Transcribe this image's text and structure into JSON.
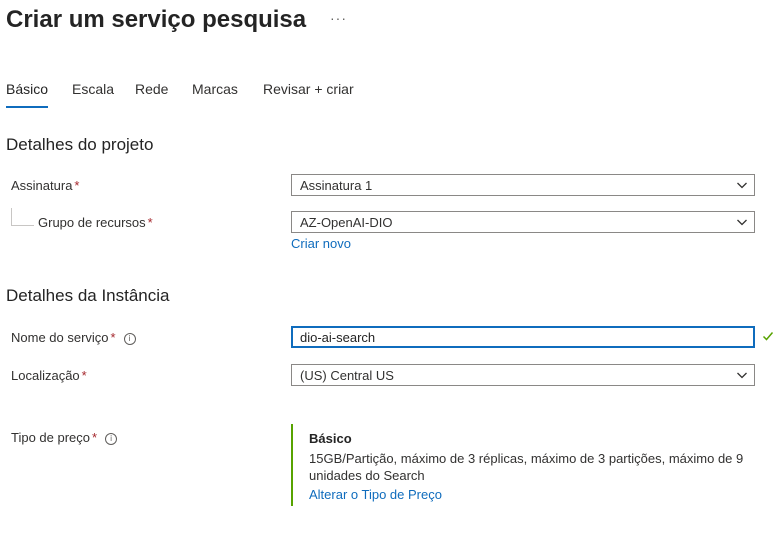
{
  "page": {
    "title": "Criar um serviço pesquisa",
    "more_label": "···"
  },
  "tabs": [
    {
      "label": "Básico",
      "active": true
    },
    {
      "label": "Escala",
      "active": false
    },
    {
      "label": "Rede",
      "active": false
    },
    {
      "label": "Marcas",
      "active": false
    },
    {
      "label": "Revisar + criar",
      "active": false
    }
  ],
  "project": {
    "heading": "Detalhes do projeto",
    "subscription_label": "Assinatura",
    "subscription_value": "Assinatura 1",
    "resource_group_label": "Grupo de recursos",
    "resource_group_value": "AZ-OpenAI-DIO",
    "create_new_link": "Criar novo"
  },
  "instance": {
    "heading": "Detalhes da Instância",
    "service_name_label": "Nome do serviço",
    "service_name_value": "dio-ai-search",
    "location_label": "Localização",
    "location_value": "(US) Central US",
    "pricing_label": "Tipo de preço",
    "pricing_tier_name": "Básico",
    "pricing_tier_description": "15GB/Partição, máximo de 3 réplicas, máximo de 3 partições, máximo de 9 unidades do Search",
    "change_pricing_link": "Alterar o Tipo de Preço"
  },
  "required_marker": "*",
  "info_icon_glyph": "i",
  "colors": {
    "accent": "#0f6cbd",
    "required": "#a4262c",
    "success": "#57a300"
  }
}
